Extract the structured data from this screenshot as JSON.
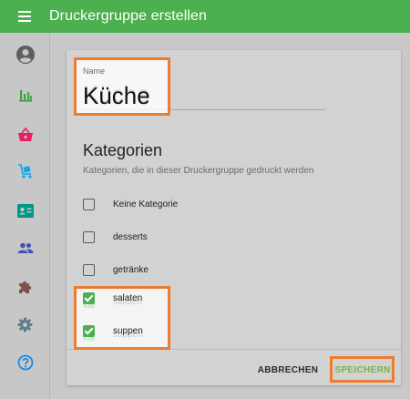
{
  "colors": {
    "primary": "#4caf50",
    "accent": "#7cb342",
    "highlight": "#ec7d2e"
  },
  "appbar": {
    "title": "Druckergruppe erstellen",
    "menu_icon": "menu-icon"
  },
  "sidebar": {
    "items": [
      {
        "icon": "account-icon",
        "color": "#5f5f5f"
      },
      {
        "icon": "bar-chart-icon",
        "color": "#43a047"
      },
      {
        "icon": "basket-icon",
        "color": "#e91e63"
      },
      {
        "icon": "cart-icon",
        "color": "#03a9f4"
      },
      {
        "icon": "contact-card-icon",
        "color": "#009688"
      },
      {
        "icon": "people-icon",
        "color": "#3f51b5"
      },
      {
        "icon": "puzzle-icon",
        "color": "#795548"
      },
      {
        "icon": "gear-icon",
        "color": "#607d8b"
      },
      {
        "icon": "help-icon",
        "color": "#1e88e5"
      }
    ]
  },
  "form": {
    "name_label": "Name",
    "name_value": "Küche",
    "section_title": "Kategorien",
    "section_subtitle": "Kategorien, die in dieser Druckergruppe gedruckt werden",
    "categories": [
      {
        "label": "Keine Kategorie",
        "checked": false
      },
      {
        "label": "desserts",
        "checked": false
      },
      {
        "label": "getränke",
        "checked": false
      },
      {
        "label": "salaten",
        "checked": true
      },
      {
        "label": "suppen",
        "checked": true
      }
    ]
  },
  "actions": {
    "cancel_label": "ABBRECHEN",
    "save_label": "SPEICHERN"
  }
}
